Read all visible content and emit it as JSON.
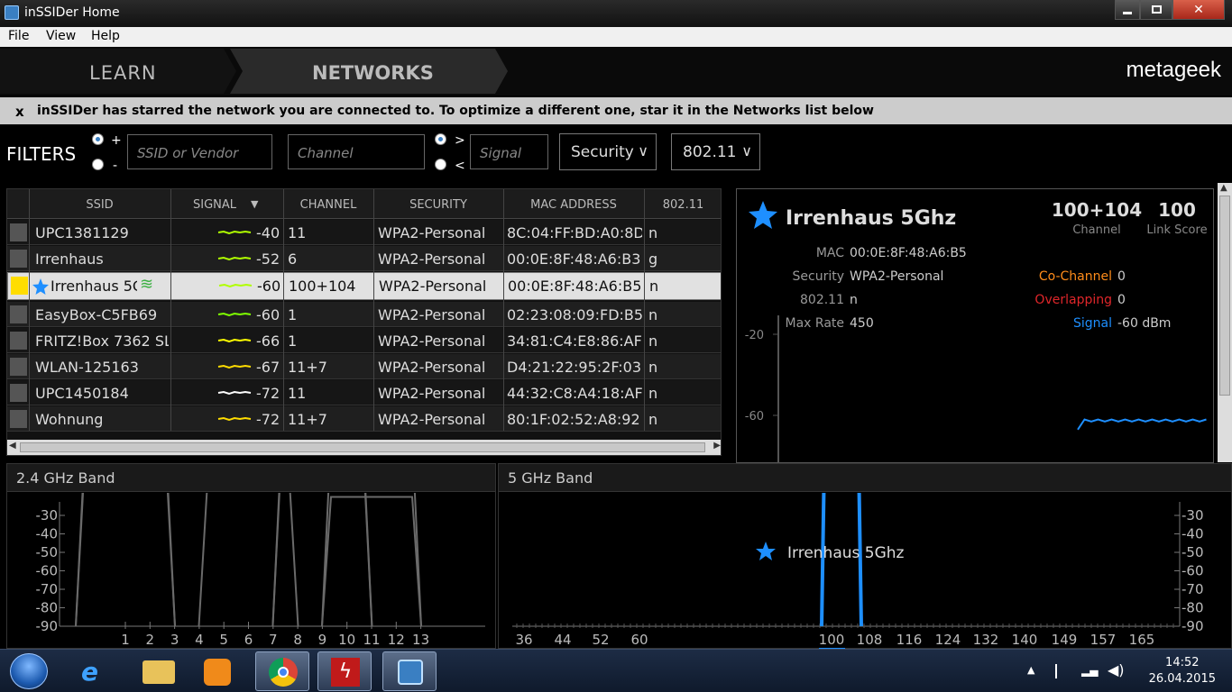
{
  "window": {
    "title": "inSSIDer Home",
    "minimize_icon": "minimize-icon",
    "maximize_icon": "maximize-icon",
    "close_icon": "close-icon",
    "close_glyph": "✕"
  },
  "menu": [
    "File",
    "View",
    "Help"
  ],
  "nav": {
    "learn": "LEARN",
    "networks": "NETWORKS",
    "logo": "metageek"
  },
  "banner": {
    "close": "x",
    "message": "inSSIDer has starred the network you are connected to. To optimize a different one, star it in the Networks list below"
  },
  "filters": {
    "label": "FILTERS",
    "plus": "+",
    "minus": "-",
    "gt": ">",
    "lt": "<",
    "ssid_placeholder": "SSID or Vendor",
    "channel_placeholder": "Channel",
    "signal_placeholder": "Signal",
    "security": "Security",
    "dot11": "802.11"
  },
  "table": {
    "headers": {
      "ssid": "SSID",
      "signal": "SIGNAL",
      "channel": "CHANNEL",
      "security": "SECURITY",
      "mac": "MAC ADDRESS",
      "dot11": "802.11"
    },
    "rows": [
      {
        "ssid": "UPC1381129",
        "signal": "-40",
        "channel": "11",
        "security": "WPA2-Personal",
        "mac": "8C:04:FF:BD:A0:8D",
        "dot11": "n",
        "color": "#b0ff00"
      },
      {
        "ssid": "Irrenhaus",
        "signal": "-52",
        "channel": "6",
        "security": "WPA2-Personal",
        "mac": "00:0E:8F:48:A6:B3",
        "dot11": "g",
        "color": "#b0ff00"
      },
      {
        "ssid": "Irrenhaus 5Ghz",
        "signal": "-60",
        "channel": "100+104",
        "security": "WPA2-Personal",
        "mac": "00:0E:8F:48:A6:B5",
        "dot11": "n",
        "color": "#b0ff00"
      },
      {
        "ssid": "EasyBox-C5FB69",
        "signal": "-60",
        "channel": "1",
        "security": "WPA2-Personal",
        "mac": "02:23:08:09:FD:B5",
        "dot11": "n",
        "color": "#7fff00"
      },
      {
        "ssid": "FRITZ!Box 7362 SL",
        "signal": "-66",
        "channel": "1",
        "security": "WPA2-Personal",
        "mac": "34:81:C4:E8:86:AF",
        "dot11": "n",
        "color": "#ffff00"
      },
      {
        "ssid": "WLAN-125163",
        "signal": "-67",
        "channel": "11+7",
        "security": "WPA2-Personal",
        "mac": "D4:21:22:95:2F:03",
        "dot11": "n",
        "color": "#ffdd00"
      },
      {
        "ssid": "UPC1450184",
        "signal": "-72",
        "channel": "11",
        "security": "WPA2-Personal",
        "mac": "44:32:C8:A4:18:AF",
        "dot11": "n",
        "color": "#ffffff"
      },
      {
        "ssid": "Wohnung",
        "signal": "-72",
        "channel": "11+7",
        "security": "WPA2-Personal",
        "mac": "80:1F:02:52:A8:92",
        "dot11": "n",
        "color": "#ffdd00"
      }
    ],
    "selected_index": 2
  },
  "detail": {
    "name": "Irrenhaus 5Ghz",
    "channel": "100+104",
    "channel_label": "Channel",
    "score": "100",
    "score_label": "Link Score",
    "mac_label": "MAC",
    "mac": "00:0E:8F:48:A6:B5",
    "security_label": "Security",
    "security": "WPA2-Personal",
    "dot11_label": "802.11",
    "dot11": "n",
    "maxrate_label": "Max Rate",
    "maxrate": "450",
    "cochannel_label": "Co-Channel",
    "cochannel": "0",
    "overlapping_label": "Overlapping",
    "overlapping": "0",
    "signal_label": "Signal",
    "signal": "-60 dBm",
    "y_ticks": [
      "-20",
      "-60"
    ],
    "history": [
      -67,
      -62,
      -63,
      -62,
      -63,
      -62,
      -63,
      -62,
      -63,
      -62,
      -63,
      -62,
      -63,
      -62,
      -63,
      -62,
      -63,
      -62,
      -63,
      -62
    ]
  },
  "band24": {
    "title": "2.4 GHz Band",
    "y_ticks": [
      "-30",
      "-40",
      "-50",
      "-60",
      "-70",
      "-80",
      "-90"
    ],
    "x_ticks": [
      "1",
      "2",
      "3",
      "4",
      "5",
      "6",
      "7",
      "8",
      "9",
      "10",
      "11",
      "12",
      "13"
    ],
    "networks": [
      {
        "center": 1,
        "signal": -60
      },
      {
        "center": 1,
        "signal": -66
      },
      {
        "center": 6,
        "signal": -52
      },
      {
        "center": 9,
        "signal": -67
      },
      {
        "center": 9,
        "signal": -72
      },
      {
        "center": 11,
        "signal": -40
      },
      {
        "center": 11,
        "signal": -72
      }
    ]
  },
  "band5": {
    "title": "5 GHz Band",
    "y_ticks": [
      "-30",
      "-40",
      "-50",
      "-60",
      "-70",
      "-80",
      "-90"
    ],
    "x_ticks": [
      "36",
      "44",
      "52",
      "60",
      "100",
      "108",
      "116",
      "124",
      "132",
      "140",
      "149",
      "157",
      "165"
    ],
    "network": {
      "name": "Irrenhaus 5Ghz",
      "channel": 100,
      "signal": -60
    }
  },
  "taskbar": {
    "time": "14:52",
    "date": "26.04.2015"
  }
}
